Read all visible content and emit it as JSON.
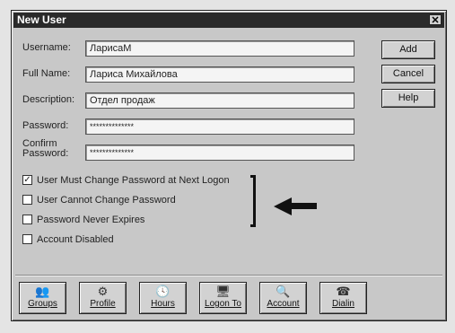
{
  "window": {
    "title": "New User",
    "close_glyph": "✕"
  },
  "form": {
    "username": {
      "label": "Username:",
      "value": "ЛарисаМ"
    },
    "full_name": {
      "label": "Full Name:",
      "value": "Лариса Михайлова"
    },
    "description": {
      "label": "Description:",
      "value": "Отдел продаж"
    },
    "password": {
      "label": "Password:",
      "value": "**************"
    },
    "confirm_password": {
      "label_line1": "Confirm",
      "label_line2": "Password:",
      "value": "**************"
    }
  },
  "side_buttons": {
    "add": "Add",
    "cancel": "Cancel",
    "help": "Help"
  },
  "checkboxes": [
    {
      "label": "User Must Change Password at Next Logon",
      "checked": true,
      "mark": "✓"
    },
    {
      "label": "User Cannot Change Password",
      "checked": false,
      "mark": ""
    },
    {
      "label": "Password Never Expires",
      "checked": false,
      "mark": ""
    },
    {
      "label": "Account Disabled",
      "checked": false,
      "mark": ""
    }
  ],
  "toolbar": [
    {
      "label": "Groups",
      "icon": "groups-icon",
      "glyph": "👥"
    },
    {
      "label": "Profile",
      "icon": "profile-icon",
      "glyph": "⚙"
    },
    {
      "label": "Hours",
      "icon": "clock-icon",
      "glyph": "🕓"
    },
    {
      "label": "Logon To",
      "icon": "computers-icon",
      "glyph": "🖥"
    },
    {
      "label": "Account",
      "icon": "account-icon",
      "glyph": "🔍"
    },
    {
      "label": "Dialin",
      "icon": "phone-icon",
      "glyph": "☎"
    }
  ]
}
